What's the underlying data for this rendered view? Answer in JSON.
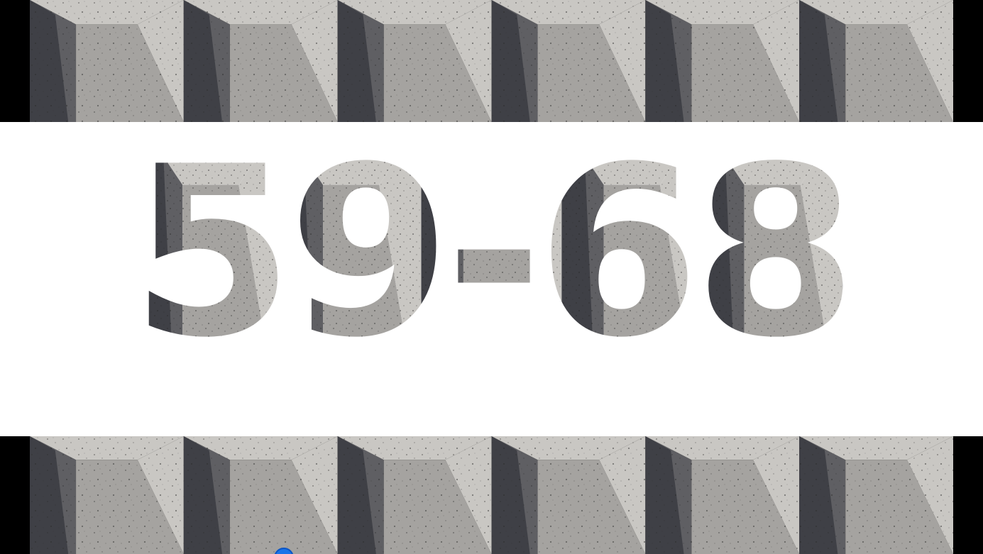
{
  "slide": {
    "title_text": "59-68"
  },
  "colors": {
    "background": "#000000",
    "panel": "#ffffff",
    "concrete_light": "#c9c7c3",
    "concrete_mid": "#a5a3a0",
    "concrete_dark": "#5f5f63",
    "concrete_shadow": "#3f4046",
    "cursor": "#1a73e8"
  },
  "pattern": {
    "tile_count": 6,
    "style": "pyramid-concrete"
  },
  "icons": {
    "cursor": "pointer-dot-icon"
  }
}
